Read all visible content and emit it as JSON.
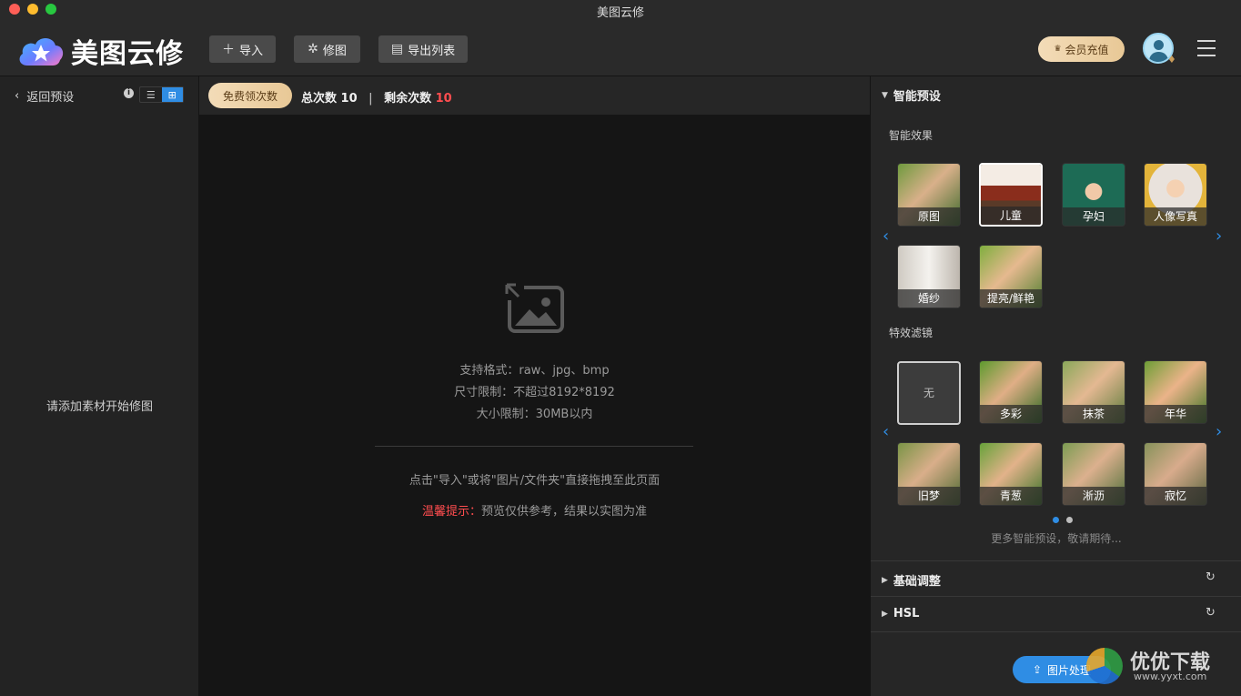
{
  "window": {
    "title": "美图云修"
  },
  "header": {
    "logo_text": "美图云修",
    "import_label": "导入",
    "retouch_label": "修图",
    "export_list_label": "导出列表",
    "vip_label": "会员充值"
  },
  "left": {
    "back_label": "返回预设",
    "empty_text": "请添加素材开始修图"
  },
  "main": {
    "free_label": "免费领次数",
    "total_label": "总次数",
    "total_value": "10",
    "remaining_label": "剩余次数",
    "remaining_value": "10",
    "format_line": "支持格式：raw、jpg、bmp",
    "size_line": "尺寸限制：不超过8192*8192",
    "filesize_line": "大小限制：30MB以内",
    "hint": "点击\"导入\"或将\"图片/文件夹\"直接拖拽至此页面",
    "tip_label": "温馨提示：",
    "tip_text": "预览仅供参考，结果以实图为准"
  },
  "right": {
    "smart_preset_title": "智能预设",
    "smart_effect_label": "智能效果",
    "effects": [
      "原图",
      "儿童",
      "孕妇",
      "人像写真",
      "婚纱",
      "提亮/鲜艳"
    ],
    "filter_label": "特效滤镜",
    "filters": [
      "无",
      "多彩",
      "抹茶",
      "年华",
      "旧梦",
      "青葱",
      "淅沥",
      "寂忆"
    ],
    "more_text": "更多智能预设，敬请期待...",
    "basic_title": "基础调整",
    "hsl_title": "HSL",
    "process_label": "图片处理"
  },
  "watermark": {
    "brand": "优优下载",
    "url": "www.yyxt.com"
  }
}
